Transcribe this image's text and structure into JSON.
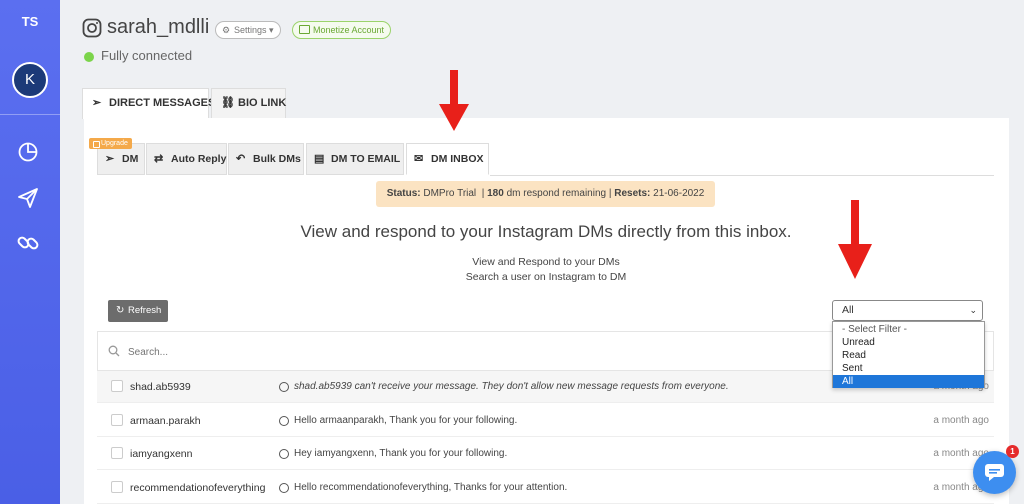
{
  "sidebar": {
    "initials": "TS",
    "avatar_letter": "K",
    "nav_icons": [
      "analytics-icon",
      "send-icon",
      "link-icon"
    ],
    "accent_color": "#5b6ff0"
  },
  "header": {
    "username": "sarah_mdlli",
    "settings_label": "Settings",
    "monetize_label": "Monetize Account",
    "connection_status": "Fully connected",
    "connection_color": "#7bd44a"
  },
  "main_tabs": [
    {
      "label": "DIRECT MESSAGES",
      "icon": "send-icon",
      "active": true
    },
    {
      "label": "BIO LINK",
      "icon": "link-icon",
      "active": false
    }
  ],
  "sub_tabs": {
    "upgrade_badge": "Upgrade",
    "items": [
      {
        "label": "DM",
        "icon": "send-icon",
        "active": false
      },
      {
        "label": "Auto Reply",
        "icon": "auto-reply-icon",
        "active": false
      },
      {
        "label": "Bulk DMs",
        "icon": "reply-all-icon",
        "active": false
      },
      {
        "label": "DM TO EMAIL",
        "icon": "document-icon",
        "active": false
      },
      {
        "label": "DM INBOX",
        "icon": "envelope-icon",
        "active": true
      }
    ]
  },
  "status": {
    "status_label": "Status:",
    "status_value": "DMPro Trial",
    "remaining_count": "180",
    "remaining_text": "dm respond remaining |",
    "resets_label": "Resets:",
    "resets_value": "21-06-2022"
  },
  "inbox": {
    "headline": "View and respond to your Instagram DMs directly from this inbox.",
    "subline_1": "View and Respond to your DMs",
    "subline_2": "Search a user on Instagram to DM",
    "refresh_label": "Refresh",
    "search_placeholder": "Search...",
    "filter": {
      "selected": "All",
      "options": [
        "- Select Filter -",
        "Unread",
        "Read",
        "Sent",
        "All"
      ]
    },
    "rows": [
      {
        "user": "shad.ab5939",
        "message": "shad.ab5939 can't receive your message. They don't allow new message requests from everyone.",
        "time": "a month ago",
        "italic": true
      },
      {
        "user": "armaan.parakh",
        "message": "Hello armaanparakh, Thank you for your following.",
        "time": "a month ago",
        "italic": false
      },
      {
        "user": "iamyangxenn",
        "message": "Hey iamyangxenn, Thank you for your following.",
        "time": "a month ago",
        "italic": false
      },
      {
        "user": "recommendationofeverything",
        "message": "Hello recommendationofeverything, Thanks for your attention.",
        "time": "a month ago",
        "italic": false
      }
    ]
  },
  "chat_widget": {
    "badge_count": "1",
    "color": "#3d8ef0"
  },
  "annotation_color": "#e8201a"
}
